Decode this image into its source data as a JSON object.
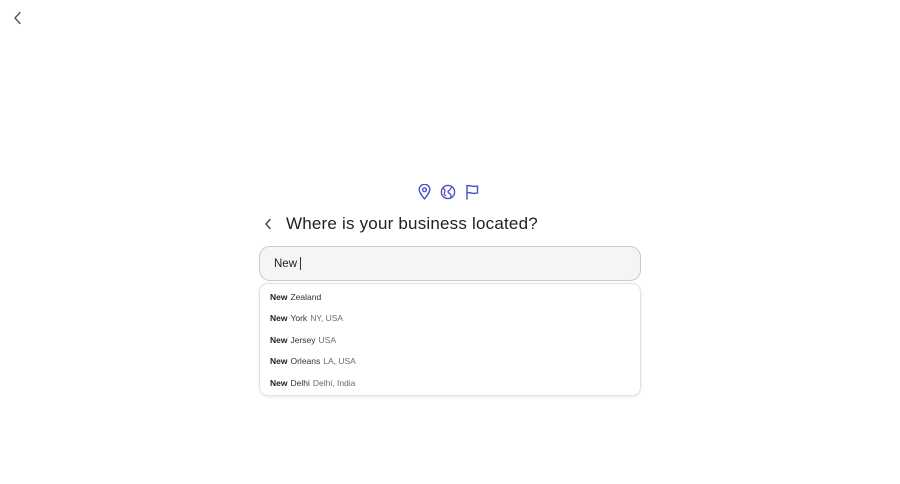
{
  "nav": {
    "back_icon": "chevron-left-icon"
  },
  "icons": {
    "location": "map-pin-icon",
    "globe": "globe-icon",
    "flag": "flag-icon",
    "accent_color": "#4a50c8"
  },
  "question": {
    "back_icon": "chevron-left-icon",
    "title": "Where is your business located?"
  },
  "search": {
    "value": "New"
  },
  "suggestions": [
    {
      "match": "New",
      "rest": "Zealand",
      "sub": ""
    },
    {
      "match": "New",
      "rest": "York",
      "sub": "NY, USA"
    },
    {
      "match": "New",
      "rest": "Jersey",
      "sub": "USA"
    },
    {
      "match": "New",
      "rest": "Orleans",
      "sub": "LA, USA"
    },
    {
      "match": "New",
      "rest": "Delhi",
      "sub": "Delhi, India"
    }
  ]
}
